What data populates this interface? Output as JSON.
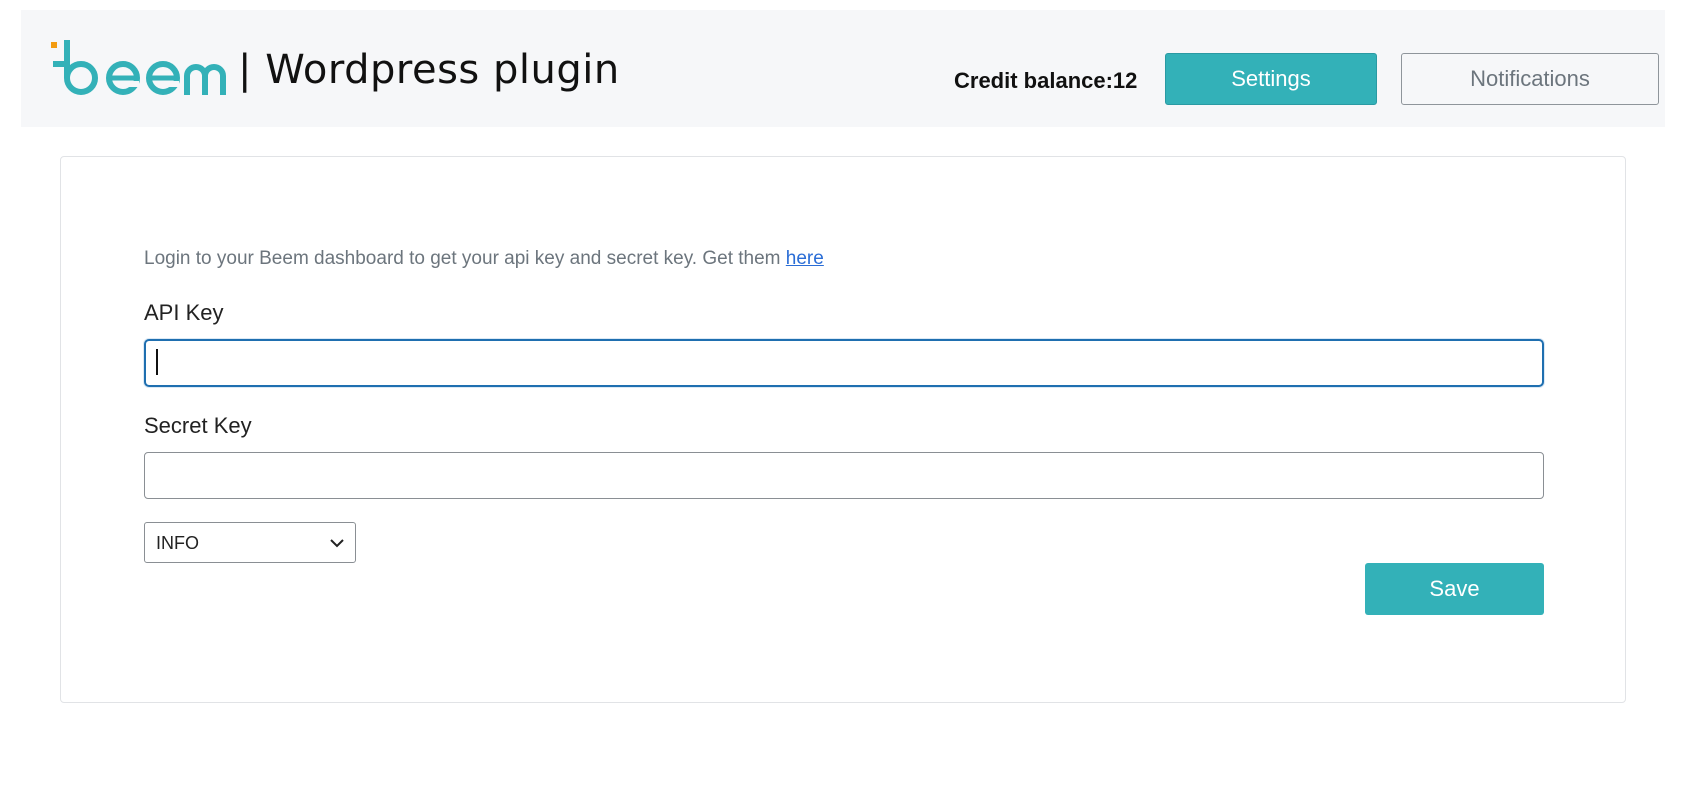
{
  "header": {
    "logo_text": "beem",
    "app_title": "| Wordpress plugin",
    "credit_balance": "Credit balance:12",
    "settings_label": "Settings",
    "notifications_label": "Notifications"
  },
  "form": {
    "intro_text": "Login to your Beem dashboard to get your api key and secret key. Get them ",
    "intro_link": "here",
    "api_key_label": "API Key",
    "api_key_value": "",
    "secret_key_label": "Secret Key",
    "secret_key_value": "",
    "log_level": "INFO",
    "save_label": "Save"
  },
  "colors": {
    "brand_teal": "#33b1b8",
    "logo_accent_orange": "#f39c12",
    "focus_border": "#1f6fb0",
    "link": "#2a6dd6"
  }
}
